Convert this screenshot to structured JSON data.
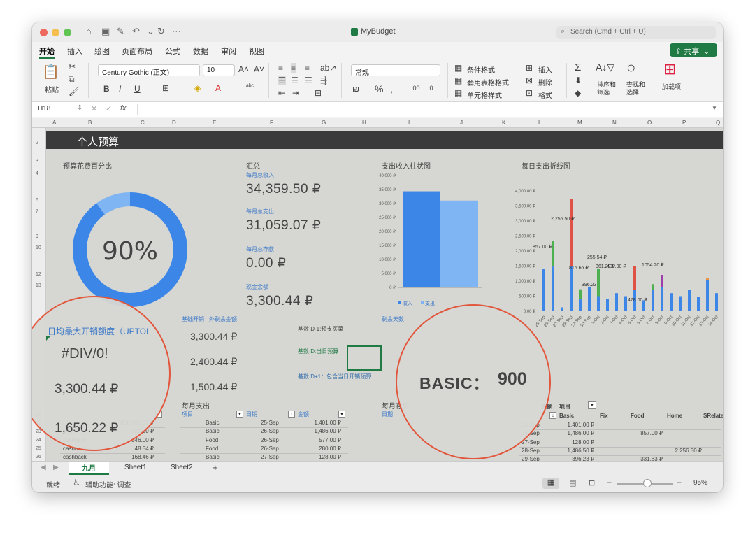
{
  "window": {
    "title": "MyBudget",
    "search_placeholder": "Search (Cmd + Ctrl + U)",
    "share_label": "共享",
    "traffic_colors": [
      "#ed6a5e",
      "#f5bf4f",
      "#61c554"
    ]
  },
  "tabs": [
    "开始",
    "插入",
    "绘图",
    "页面布局",
    "公式",
    "数据",
    "审阅",
    "视图"
  ],
  "ribbon": {
    "paste": "粘贴",
    "font_name": "Century Gothic (正文)",
    "font_size": "10",
    "number_format": "常规",
    "conditional_format": "条件格式",
    "table_format": "套用表格格式",
    "cell_style": "单元格样式",
    "insert": "插入",
    "delete": "删除",
    "format": "格式",
    "sort_filter": "排序和筛选",
    "find_select": "查找和选择",
    "addins": "加载项"
  },
  "formula_bar": {
    "name_box": "H18",
    "fx": "fx"
  },
  "columns": [
    "A",
    "B",
    "C",
    "D",
    "E",
    "F",
    "G",
    "H",
    "I",
    "J",
    "K",
    "L",
    "M",
    "N",
    "O",
    "P",
    "Q"
  ],
  "rows": [
    "2",
    "3",
    "4",
    "6",
    "7",
    "9",
    "10",
    "12",
    "13",
    "21",
    "22",
    "23",
    "24",
    "25",
    "26"
  ],
  "sheet": {
    "title": "个人预算",
    "pct_label": "预算花费百分比",
    "pct_value": "90%",
    "pct_fraction": 0.9,
    "summary_label": "汇总",
    "monthly_income_label": "每月总收入",
    "monthly_income": "34,359.50 ₽",
    "monthly_expense_label": "每月总支出",
    "monthly_expense": "31,059.07 ₽",
    "monthly_savings_label": "每月总存款",
    "monthly_savings": "0.00 ₽",
    "cash_balance_label": "现金余额",
    "cash_balance": "3,300.44 ₽",
    "bar_chart_label": "支出收入柱状图",
    "line_chart_label": "每日支出折线图",
    "daily_max_label": "日均最大开销额度（UPTOL",
    "div_error": "#DIV/0!",
    "daily_value_1": "3,300.44 ₽",
    "daily_value_2": "1,650.22 ₽",
    "basic_spend_label": "基础开销",
    "extra_balance_label": "外剩余金额",
    "mid_value_1": "3,300.44 ₽",
    "mid_value_2": "2,400.44 ₽",
    "mid_value_3": "1,500.44 ₽",
    "basic_d1_label": "基数 D-1:预支买菜",
    "basic_d_label": "基数 D:当日预算",
    "basic_d_plus_label": "基数 D+1：包含当日开销预算",
    "remaining_days_label": "剩余天数",
    "basic_label": "BASIC：",
    "basic_value": "900",
    "monthly_spend_label": "每月支出",
    "monthly_savings_table_label": "每月存款",
    "col_item": "项目",
    "col_date": "日期",
    "col_amount": "金额",
    "col_amount2": "金额",
    "col_basic": "Basic",
    "col_fix": "Fix",
    "col_food": "Food",
    "col_home": "Home",
    "col_srelate": "SRelate",
    "right_col_item": "项目"
  },
  "left_table": [
    [
      "",
      "₽38,000.00 ₽"
    ],
    [
      "结余",
      "520.00 ₽"
    ],
    [
      "cashback",
      "546.00 ₽"
    ],
    [
      "cashback",
      "48.54 ₽"
    ],
    [
      "cashback",
      "168.46 ₽"
    ]
  ],
  "mid_table": [
    [
      "Basic",
      "25-Sep",
      "1,401.00 ₽"
    ],
    [
      "Basic",
      "26-Sep",
      "1,486.00 ₽"
    ],
    [
      "Food",
      "26-Sep",
      "577.00 ₽"
    ],
    [
      "Food",
      "26-Sep",
      "280.00 ₽"
    ],
    [
      "Basic",
      "27-Sep",
      "128.00 ₽"
    ]
  ],
  "right_table": [
    [
      "25-Sep",
      "1,401.00 ₽",
      "",
      ""
    ],
    [
      "26-Sep",
      "1,486.00 ₽",
      "857.00 ₽",
      ""
    ],
    [
      "27-Sep",
      "128.00 ₽",
      "",
      ""
    ],
    [
      "28-Sep",
      "1,486.50 ₽",
      "",
      "2,256.50 ₽"
    ],
    [
      "29-Sep",
      "396.23 ₽",
      "331.83 ₽",
      ""
    ]
  ],
  "chart_data": [
    {
      "type": "bar",
      "title": "支出收入柱状图",
      "categories": [
        ""
      ],
      "series": [
        {
          "name": "收入",
          "values": [
            34359.5
          ],
          "color": "#3c86e8"
        },
        {
          "name": "支出",
          "values": [
            31059.07
          ],
          "color": "#7fb5f3"
        }
      ],
      "y_ticks": [
        "0 ₽",
        "5,000 ₽",
        "10,000 ₽",
        "15,000 ₽",
        "20,000 ₽",
        "25,000 ₽",
        "30,000 ₽",
        "35,000 ₽",
        "40,000 ₽"
      ],
      "ylim": [
        0,
        40000
      ]
    },
    {
      "type": "bar",
      "title": "每日支出折线图",
      "y_ticks": [
        "0.00 ₽",
        "500.00 ₽",
        "1,000.00 ₽",
        "1,500.00 ₽",
        "2,000.00 ₽",
        "2,500.00 ₽",
        "3,000.00 ₽",
        "3,500.00 ₽",
        "4,000.00 ₽"
      ],
      "ylim": [
        0,
        4000
      ],
      "x": [
        "25-Sep",
        "26-Sep",
        "27-Sep",
        "28-Sep",
        "29-Sep",
        "30-Sep",
        "1-Oct",
        "2-Oct",
        "3-Oct",
        "4-Oct",
        "5-Oct",
        "6-Oct",
        "7-Oct",
        "8-Oct",
        "9-Oct",
        "10-Oct",
        "11-Oct",
        "12-Oct",
        "13-Oct",
        "14-Oct"
      ],
      "stacks": [
        [
          {
            "v": 1401,
            "c": "#3c86e8"
          }
        ],
        [
          {
            "v": 1486,
            "c": "#3c86e8"
          },
          {
            "v": 857,
            "c": "#4caf50"
          }
        ],
        [
          {
            "v": 128,
            "c": "#3c86e8"
          }
        ],
        [
          {
            "v": 1486.5,
            "c": "#3c86e8"
          },
          {
            "v": 2256.5,
            "c": "#e05245"
          }
        ],
        [
          {
            "v": 396.23,
            "c": "#3c86e8"
          },
          {
            "v": 331.83,
            "c": "#4caf50"
          }
        ],
        [
          {
            "v": 816.66,
            "c": "#3c86e8"
          }
        ],
        [
          {
            "v": 500,
            "c": "#3c86e8"
          },
          {
            "v": 900,
            "c": "#4caf50"
          }
        ],
        [
          {
            "v": 400,
            "c": "#3c86e8"
          }
        ],
        [
          {
            "v": 600,
            "c": "#3c86e8"
          }
        ],
        [
          {
            "v": 500,
            "c": "#3c86e8"
          }
        ],
        [
          {
            "v": 700,
            "c": "#3c86e8"
          },
          {
            "v": 800,
            "c": "#e05245"
          }
        ],
        [
          {
            "v": 361.29,
            "c": "#3c86e8"
          }
        ],
        [
          {
            "v": 700,
            "c": "#3c86e8"
          },
          {
            "v": 200,
            "c": "#4caf50"
          }
        ],
        [
          {
            "v": 800,
            "c": "#3c86e8"
          },
          {
            "v": 409,
            "c": "#9c3fa8"
          }
        ],
        [
          {
            "v": 600,
            "c": "#3c86e8"
          }
        ],
        [
          {
            "v": 500,
            "c": "#3c86e8"
          }
        ],
        [
          {
            "v": 700,
            "c": "#3c86e8"
          }
        ],
        [
          {
            "v": 478,
            "c": "#3c86e8"
          }
        ],
        [
          {
            "v": 1050,
            "c": "#3c86e8"
          },
          {
            "v": 40,
            "c": "#f08a2c"
          }
        ],
        [
          {
            "v": 600,
            "c": "#3c86e8"
          }
        ]
      ],
      "data_labels": [
        "857.00 ₽",
        "2,256.50 ₽",
        "816.66 ₽",
        "255.54 ₽",
        "361.29 ₽",
        "409.00 ₽",
        "1054.20 ₽",
        "478.00 ₽",
        "396.23"
      ]
    }
  ],
  "sheet_tabs": [
    "九月",
    "Sheet1",
    "Sheet2",
    "+"
  ],
  "status": {
    "ready": "就绪",
    "accessibility": "辅助功能: 调查",
    "zoom": "95%",
    "zoom_fraction": 0.55
  }
}
